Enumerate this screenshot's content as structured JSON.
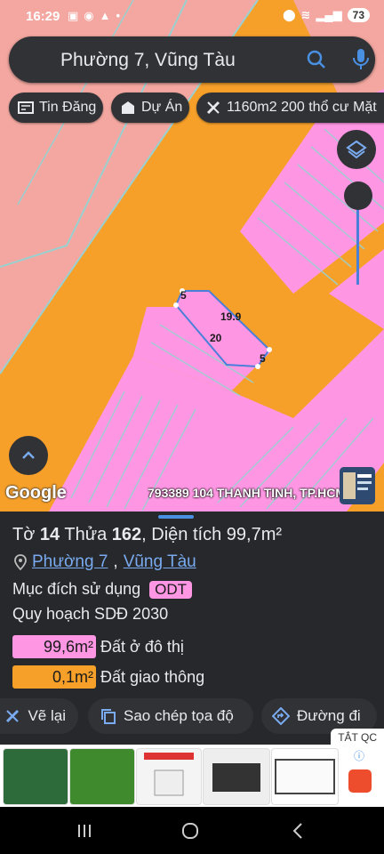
{
  "status": {
    "time": "16:29",
    "battery": "73"
  },
  "search": {
    "query": "Phường 7, Vũng Tàu"
  },
  "chips": [
    {
      "label": "Tin Đăng",
      "icon": "newspaper-icon"
    },
    {
      "label": "Dự Án",
      "icon": "building-icon"
    },
    {
      "label": "1160m2 200 thổ cư Mặt",
      "icon": "ruler-icon"
    }
  ],
  "map": {
    "parcel_labels": {
      "top": "5",
      "long_top": "19.9",
      "long_bottom": "20",
      "right": "5"
    },
    "watermark": "Google",
    "address_overlay": "793389 104 THANH TỊNH, TP.HCM",
    "colors": {
      "land_orange": "#f6a02a",
      "residential_pink": "#ff96e4",
      "salmon": "#f3a7a0"
    }
  },
  "info": {
    "title": {
      "sheet_label": "Tờ",
      "sheet_no": "14",
      "plot_label": "Thửa",
      "plot_no": "162",
      "area_label": "Diện tích",
      "area": "99,7m²"
    },
    "location": {
      "ward": "Phường 7",
      "city": "Vũng Tàu",
      "separator": ","
    },
    "purpose_label": "Mục đích sử dụng",
    "purpose_code": "ODT",
    "planning": "Quy hoạch SDĐ 2030",
    "areas": [
      {
        "value": "99,6m²",
        "label": "Đất ở đô thị",
        "color": "#ff96e4"
      },
      {
        "value": "0,1m²",
        "label": "Đất giao thông",
        "color": "#f6a02a"
      }
    ]
  },
  "actions": {
    "redraw": "Vẽ lại",
    "copy": "Sao chép tọa độ",
    "directions": "Đường đi"
  },
  "ad": {
    "close": "TẮT QC"
  }
}
